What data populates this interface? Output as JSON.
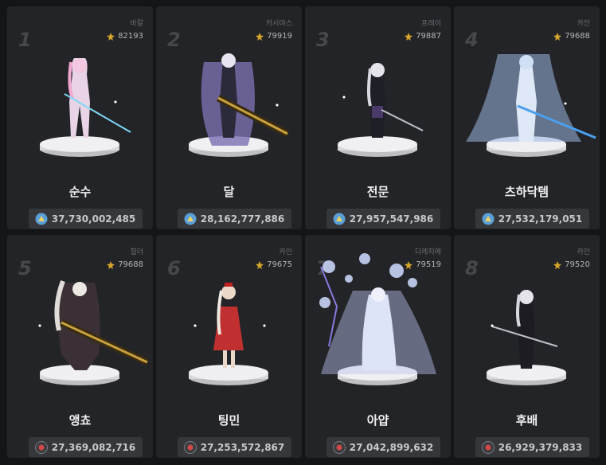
{
  "cards": [
    {
      "rank": "1",
      "server": "바칼",
      "fame": "82193",
      "name": "순수",
      "damage": "37,730,002,485"
    },
    {
      "rank": "2",
      "server": "카시야스",
      "fame": "79919",
      "name": "달",
      "damage": "28,162,777,886"
    },
    {
      "rank": "3",
      "server": "프레이",
      "fame": "79887",
      "name": "전문",
      "damage": "27,957,547,986"
    },
    {
      "rank": "4",
      "server": "카인",
      "fame": "79688",
      "name": "츠하닥템",
      "damage": "27,532,179,051"
    },
    {
      "rank": "5",
      "server": "힐더",
      "fame": "79688",
      "name": "앵쵸",
      "damage": "27,369,082,716"
    },
    {
      "rank": "6",
      "server": "카인",
      "fame": "79675",
      "name": "팅민",
      "damage": "27,253,572,867"
    },
    {
      "rank": "7",
      "server": "디레지에",
      "fame": "79519",
      "name": "아얍",
      "damage": "27,042,899,632"
    },
    {
      "rank": "8",
      "server": "카인",
      "fame": "79520",
      "name": "후배",
      "damage": "26,929,379,833"
    }
  ],
  "icons": {
    "fame": "fame-icon",
    "damage_buff": "buffer-icon",
    "damage_attack": "damage-icon"
  },
  "colors": {
    "fame_icon": "#d4a52c",
    "card_bg": "#232427",
    "page_bg": "#141517"
  }
}
